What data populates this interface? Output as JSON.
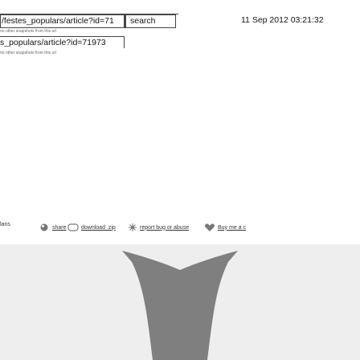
{
  "toolbar": {
    "url_value": "/festes_populars/article?id=71",
    "search_label": "search",
    "date": "11 Sep 2012 03:21:32"
  },
  "snapshots": [
    {
      "note": "no other snapshots from this url",
      "url": "s_populars/article?id=71973"
    },
    {
      "note": "no other snapshots from this url"
    }
  ],
  "language": "lans",
  "actions": [
    {
      "label": "share",
      "icon": "share-icon"
    },
    {
      "label": "download .zip",
      "icon": "download-icon"
    },
    {
      "label": "report bug or abuse",
      "icon": "report-icon"
    },
    {
      "label": "Buy me a c",
      "icon": "heart-icon"
    }
  ],
  "colors": {
    "banner_bg": "#eeeeee",
    "banner_shape": "#7f7f7f"
  }
}
